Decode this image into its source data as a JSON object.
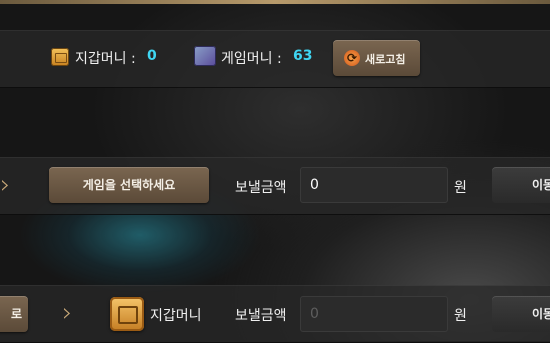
{
  "wallet": {
    "label": "지갑머니 :",
    "value": "0"
  },
  "game_money": {
    "label": "게임머니 :",
    "value": "63"
  },
  "refresh_button": "새로고침",
  "transfer_row_1": {
    "select_game_button": "게임을 선택하세요",
    "amount_label": "보낼금액",
    "amount_value": "0",
    "currency": "원",
    "move_button": "이동"
  },
  "transfer_row_2": {
    "left_button": "로",
    "wallet_label": "지갑머니",
    "amount_label": "보낼금액",
    "amount_placeholder": "0",
    "currency": "원",
    "move_button": "이동"
  },
  "icons": [
    "wallet-icon",
    "game-money-icon",
    "refresh-icon",
    "chevron-right-icon",
    "safe-icon"
  ],
  "colors": {
    "accent_value": "#3fd6f2",
    "brown_button": "#6b5843",
    "chevron": "#c9a978"
  }
}
